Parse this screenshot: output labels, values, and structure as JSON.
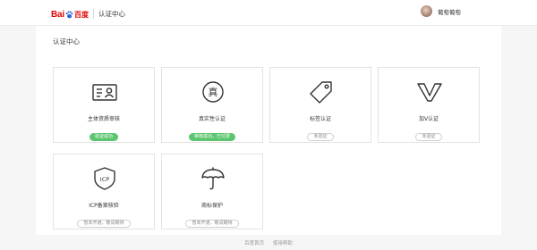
{
  "header": {
    "logo": {
      "bai": "Bai",
      "du": "百度"
    },
    "center_title": "认证中心",
    "user": {
      "name": "葡萄葡萄"
    }
  },
  "page": {
    "title": "认证中心"
  },
  "cards": [
    {
      "label": "主体资质审核",
      "badge": "验证成功",
      "status": "ok",
      "icon": "id-card-icon"
    },
    {
      "label": "真实性认证",
      "badge": "审核成功，已付费",
      "status": "ok",
      "icon": "zhen-seal-icon"
    },
    {
      "label": "标签认证",
      "badge": "未验证",
      "status": "grey",
      "icon": "tag-icon"
    },
    {
      "label": "加V认证",
      "badge": "未验证",
      "status": "grey",
      "icon": "v-mark-icon"
    },
    {
      "label": "ICP备案核验",
      "badge": "暂未开通，敬请期待",
      "status": "grey",
      "icon": "icp-shield-icon"
    },
    {
      "label": "商标保护",
      "badge": "暂未开通，敬请期待",
      "status": "grey",
      "icon": "umbrella-icon"
    }
  ],
  "icon_text": {
    "zhen": "真",
    "icp": "ICP"
  },
  "footer": {
    "links": [
      "百度首页",
      "使用帮助"
    ]
  },
  "colors": {
    "brand_red": "#e10602",
    "success_green": "#5cc56f"
  }
}
